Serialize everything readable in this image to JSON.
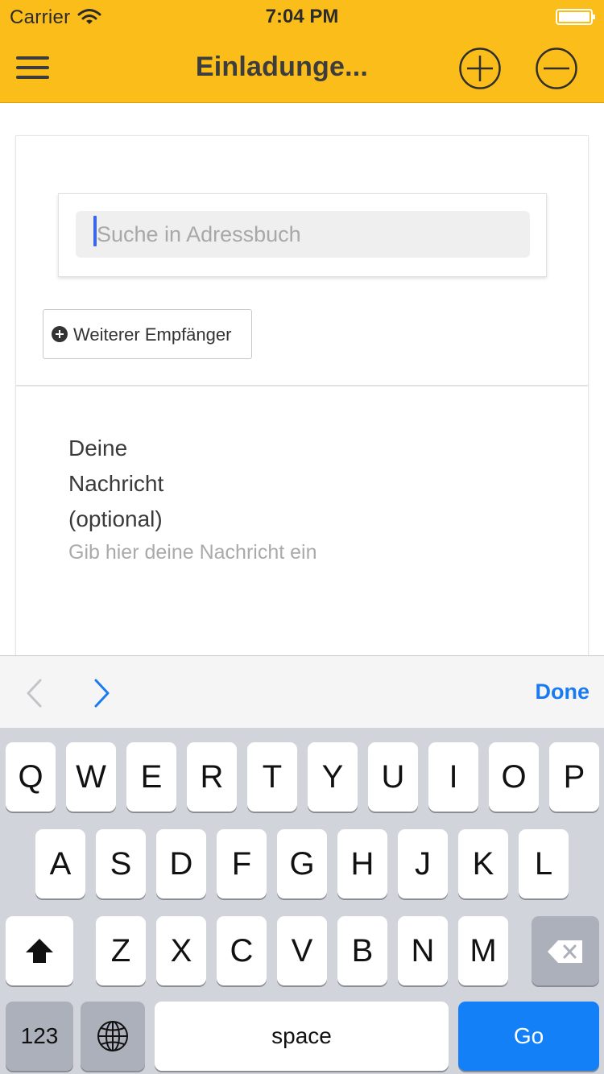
{
  "status_bar": {
    "carrier": "Carrier",
    "time": "7:04 PM",
    "icons": [
      "wifi-icon",
      "battery-icon"
    ]
  },
  "nav": {
    "menu_icon": "hamburger-menu-icon",
    "title": "Einladunge...",
    "add_icon": "plus-circle-icon",
    "remove_icon": "minus-circle-icon"
  },
  "form": {
    "search_placeholder": "Suche in Adressbuch",
    "search_value": "",
    "add_recipient_label": "Weiterer Empfänger",
    "add_recipient_icon": "plus-circle-icon",
    "message_label_lines": [
      "Deine",
      "Nachricht",
      "(optional)"
    ],
    "message_placeholder": "Gib hier deine Nachricht ein",
    "message_value": ""
  },
  "accessory_bar": {
    "prev_icon": "chevron-left-icon",
    "next_icon": "chevron-right-icon",
    "done_label": "Done"
  },
  "keyboard": {
    "row1": [
      "Q",
      "W",
      "E",
      "R",
      "T",
      "Y",
      "U",
      "I",
      "O",
      "P"
    ],
    "row2": [
      "A",
      "S",
      "D",
      "F",
      "G",
      "H",
      "J",
      "K",
      "L"
    ],
    "row3": [
      "Z",
      "X",
      "C",
      "V",
      "B",
      "N",
      "M"
    ],
    "shift_icon": "shift-arrow-icon",
    "backspace_icon": "backspace-icon",
    "numbers_label": "123",
    "globe_icon": "globe-icon",
    "space_label": "space",
    "go_label": "Go"
  },
  "colors": {
    "nav_background": "#fbbd19",
    "accent_blue": "#1380f7",
    "done_blue": "#1a7bf0",
    "keyboard_background": "#d1d4da"
  }
}
